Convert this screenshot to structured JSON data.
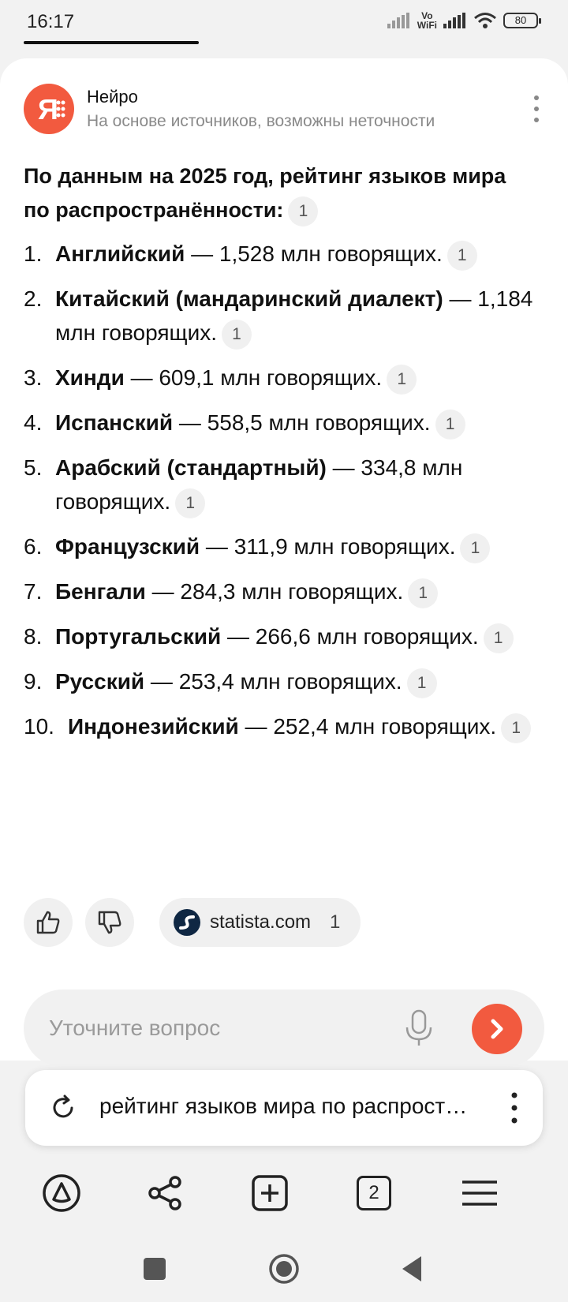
{
  "status_bar": {
    "time": "16:17",
    "vowifi_top": "Vo",
    "vowifi_bottom": "WiFi",
    "battery": "80"
  },
  "header": {
    "title": "Нейро",
    "subtitle": "На основе источников, возможны неточности",
    "logo_icon": "yandex-neuro-icon",
    "accent_color": "#f25a3f"
  },
  "answer": {
    "intro": "По данным на 2025 год, рейтинг языков мира по распространённости:",
    "intro_cite": "1",
    "items": [
      {
        "num": "1.",
        "name": "Английский",
        "rest": " — 1,528 млн говорящих.",
        "cite": "1"
      },
      {
        "num": "2.",
        "name": "Китайский (мандаринский диалект)",
        "rest": " — 1,184 млн говорящих.",
        "cite": "1"
      },
      {
        "num": "3.",
        "name": "Хинди",
        "rest": " — 609,1 млн говорящих.",
        "cite": "1"
      },
      {
        "num": "4.",
        "name": "Испанский",
        "rest": " — 558,5 млн говорящих.",
        "cite": "1"
      },
      {
        "num": "5.",
        "name": "Арабский (стандартный)",
        "rest": " — 334,8 млн говорящих.",
        "cite": "1"
      },
      {
        "num": "6.",
        "name": "Французский",
        "rest": " — 311,9 млн говорящих.",
        "cite": "1"
      },
      {
        "num": "7.",
        "name": "Бенгали",
        "rest": " — 284,3 млн говорящих.",
        "cite": "1"
      },
      {
        "num": "8.",
        "name": "Португальский",
        "rest": " — 266,6 млн говорящих.",
        "cite": "1"
      },
      {
        "num": "9.",
        "name": "Русский",
        "rest": " — 253,4 млн говорящих.",
        "cite": "1"
      },
      {
        "num": "10.",
        "name": "Индонезийский",
        "rest": " — 252,4 млн говорящих.",
        "cite": "1"
      }
    ]
  },
  "actions": {
    "source_name": "statista.com",
    "source_count": "1"
  },
  "ask": {
    "placeholder": "Уточните вопрос"
  },
  "query": {
    "text": "рейтинг языков мира по распространённости"
  },
  "toolbar": {
    "tabs_count": "2"
  }
}
